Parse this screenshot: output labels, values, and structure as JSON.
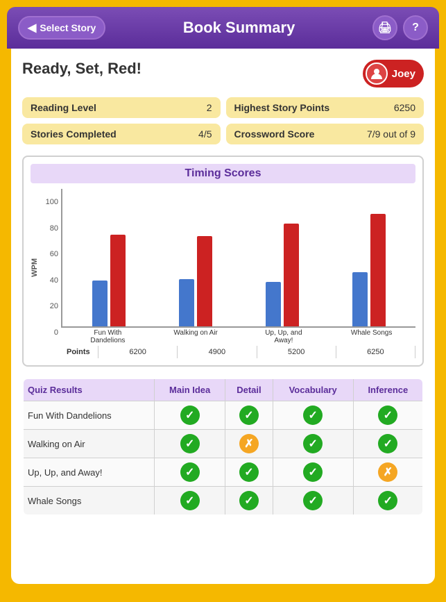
{
  "header": {
    "title": "Book Summary",
    "back_label": "Select Story",
    "print_icon": "🖨",
    "help_icon": "?"
  },
  "book": {
    "title": "Ready, Set, Red!"
  },
  "user": {
    "name": "Joey"
  },
  "stats": {
    "reading_level_label": "Reading Level",
    "reading_level_value": "2",
    "stories_completed_label": "Stories Completed",
    "stories_completed_value": "4/5",
    "highest_story_points_label": "Highest Story Points",
    "highest_story_points_value": "6250",
    "crossword_score_label": "Crossword Score",
    "crossword_score_value": "7/9 out of 9"
  },
  "chart": {
    "title": "Timing Scores",
    "y_axis_label": "WPM",
    "y_axis_values": [
      "100",
      "80",
      "60",
      "40",
      "20",
      "0"
    ],
    "groups": [
      {
        "label": "Fun With\nDandelions",
        "blue_value": 33,
        "red_value": 66,
        "points": "6200",
        "blue_pct": 33,
        "red_pct": 66
      },
      {
        "label": "Walking on Air",
        "blue_value": 34,
        "red_value": 65,
        "points": "4900",
        "blue_pct": 34,
        "red_pct": 65
      },
      {
        "label": "Up, Up, and\nAway!",
        "blue_value": 32,
        "red_value": 74,
        "points": "5200",
        "blue_pct": 32,
        "red_pct": 74
      },
      {
        "label": "Whale Songs",
        "blue_value": 39,
        "red_value": 81,
        "points": "6250",
        "blue_pct": 39,
        "red_pct": 81
      }
    ]
  },
  "quiz": {
    "title": "Quiz Results",
    "columns": [
      "Main Idea",
      "Detail",
      "Vocabulary",
      "Inference"
    ],
    "rows": [
      {
        "story": "Fun With Dandelions",
        "results": [
          "check",
          "check",
          "check",
          "check"
        ]
      },
      {
        "story": "Walking on Air",
        "results": [
          "check",
          "cross",
          "check",
          "check"
        ]
      },
      {
        "story": "Up, Up, and Away!",
        "results": [
          "check",
          "check",
          "check",
          "cross"
        ]
      },
      {
        "story": "Whale Songs",
        "results": [
          "check",
          "check",
          "check",
          "check"
        ]
      }
    ]
  }
}
